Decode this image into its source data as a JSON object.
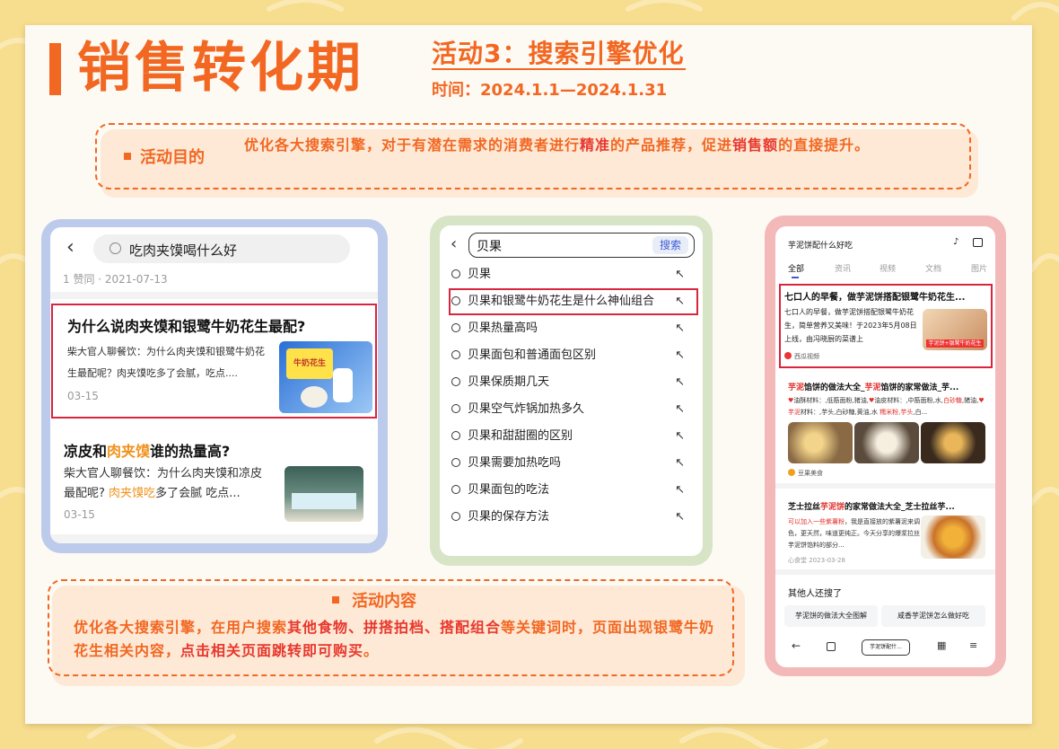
{
  "header": {
    "title": "销售转化期",
    "activity_title": "活动3：搜索引擎优化",
    "activity_time": "时间：2024.1.1—2024.1.31"
  },
  "goal": {
    "label": "活动目的",
    "text_1": "优化各大搜索引擎，对于有潜在需求的消费者进行",
    "text_hl_1": "精准",
    "text_2": "的产品推荐，促进",
    "text_hl_2": "销售额",
    "text_3": "的直接提升。"
  },
  "panel_zhihu": {
    "search_query": "吃肉夹馍喝什么好",
    "meta": "1 赞同 · 2021-07-13",
    "card1": {
      "title": "为什么说肉夹馍和银鹭牛奶花生最配?",
      "snippet": "柴大官人聊餐饮：为什么肉夹馍和银鹭牛奶花生最配呢？肉夹馍吃多了会腻，吃点....",
      "date": "03-15"
    },
    "card2": {
      "title_a": "凉皮和",
      "title_hl": "肉夹馍",
      "title_b": "谁的热量高?",
      "snippet_a": "柴大官人聊餐饮：为什么肉夹馍和凉皮最配呢? ",
      "snippet_hl": "肉夹馍吃",
      "snippet_b": "多了会腻 吃点...",
      "date": "03-15"
    },
    "product_text": "牛奶花生"
  },
  "panel_search": {
    "query": "贝果",
    "search_button": "搜索",
    "suggestions": [
      "贝果",
      "贝果和银鹭牛奶花生是什么神仙组合",
      "贝果热量高吗",
      "贝果面包和普通面包区别",
      "贝果保质期几天",
      "贝果空气炸锅加热多久",
      "贝果和甜甜圈的区别",
      "贝果需要加热吃吗",
      "贝果面包的吃法",
      "贝果的保存方法"
    ]
  },
  "panel_result": {
    "query": "芋泥饼配什么好吃",
    "tabs": [
      "全部",
      "资讯",
      "视频",
      "文档",
      "图片"
    ],
    "r1": {
      "title": "七口人的早餐，做芋泥饼搭配银鹭牛奶花生...",
      "snippet": "七口人的早餐，做芋泥饼搭配银鹭牛奶花生，简单营养又美味！于2023年5月08日上线，由冯晓厨的菜谱上",
      "source": "西瓜视频",
      "thumb_caption": "芋泥饼+银鹭牛奶花生"
    },
    "r2": {
      "title_hl_1": "芋泥",
      "title_a": "馅饼的做法大全_",
      "title_hl_2": "芋泥",
      "title_b": "馅饼的家常做法_芋...",
      "snippet_a": "油酥材料：,低筋面粉,猪油,",
      "snippet_b": "油皮材料：,中筋面粉,水,",
      "snippet_hl_1": "白砂糖",
      "snippet_c": ",猪油,",
      "snippet_hl_2": "芋泥",
      "snippet_d": "材料：,芋头,白砂糖,黄油,水 ",
      "snippet_hl_3": "糯米粉,芋头",
      "snippet_e": ",白...",
      "source": "豆果美食"
    },
    "r3": {
      "title_a": "芝士拉丝",
      "title_hl": "芋泥饼",
      "title_b": "的家常做法大全_芝士拉丝芋...",
      "snippet_hl": "可以加入一些紫薯粉",
      "snippet": "，我是直接放的紫薯泥来调色，更天然，味道更纯正。今天分享的爆浆拉丝芋泥饼馅料的部分...",
      "source": "心食堂  2023-03-28"
    },
    "others_title": "其他人还搜了",
    "others": [
      "芋泥饼的做法大全图解",
      "咸香芋泥饼怎么做好吃"
    ],
    "bottom_tab": "芋泥饼配什..."
  },
  "content": {
    "label": "活动内容",
    "text_1": "优化各大搜索引擎，在用户搜索",
    "text_hl_1": "其他食物、拼搭拍档、搭配组合",
    "text_2": "等关键词时，页面出现银鹭牛奶花生相关内容，",
    "text_hl_2": "点击相关页面跳转即可购买",
    "text_3": "。"
  },
  "colors": {
    "accent": "#f26722",
    "highlight": "#e8372c",
    "background": "#f7dd8e",
    "sheet": "#fdfaf4"
  }
}
